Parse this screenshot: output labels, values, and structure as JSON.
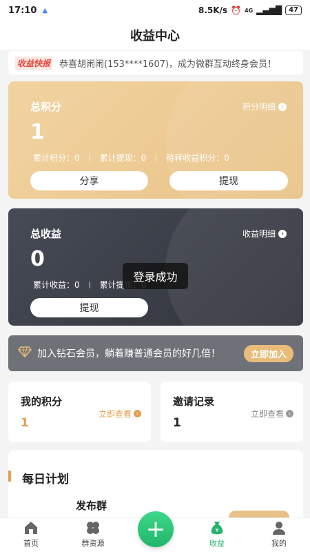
{
  "status": {
    "time": "17:10",
    "network_speed": "8.5K/s",
    "network_type": "4G",
    "battery": "47"
  },
  "header": {
    "title": "收益中心"
  },
  "ticker": {
    "tag": "收益快报",
    "text": "恭喜胡闹闹(153****1607)，成为微群互动终身会员！"
  },
  "points_card": {
    "title": "总积分",
    "link": "积分明细",
    "value": "1",
    "stats": [
      "累计积分：0",
      "累计提现：0",
      "待转收益积分：0"
    ],
    "share_button": "分享",
    "withdraw_button": "提现",
    "color": "#eac388"
  },
  "income_card": {
    "title": "总收益",
    "link": "收益明细",
    "value": "0",
    "stats": [
      "累计收益：0",
      "累计提现：0"
    ],
    "withdraw_button": "提现",
    "color": "#30333a"
  },
  "toast": "登录成功",
  "banner": {
    "icon": "diamond-icon",
    "text": "加入钻石会员，躺着赚普通会员的好几倍！",
    "button": "立即加入"
  },
  "my_points": {
    "title": "我的积分",
    "link": "立即查看",
    "value": "1",
    "accent": "#e3a050"
  },
  "invite_records": {
    "title": "邀请记录",
    "link": "立即查看",
    "value": "1"
  },
  "daily_plan": {
    "title": "每日计划",
    "item": "发布群"
  },
  "tabbar": {
    "tabs": [
      {
        "label": "首页",
        "icon": "home-icon"
      },
      {
        "label": "群资源",
        "icon": "grid-icon"
      },
      {
        "label": "",
        "icon": "plus-icon"
      },
      {
        "label": "收益",
        "icon": "money-bag-icon"
      },
      {
        "label": "我的",
        "icon": "user-icon"
      }
    ],
    "active_color": "#27b36b"
  }
}
